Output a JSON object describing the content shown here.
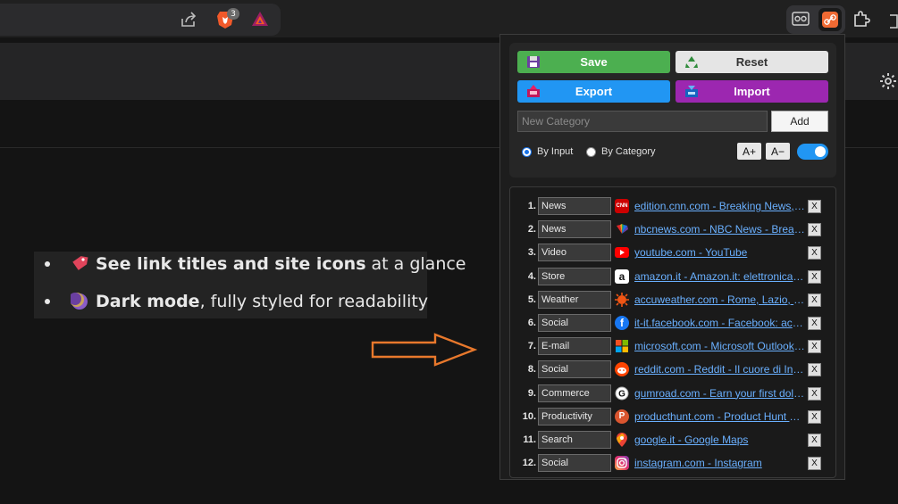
{
  "browser": {
    "brave_badge": "3"
  },
  "features": [
    {
      "bold": "See link titles and site icons",
      "rest": "at a glance"
    },
    {
      "bold": "Dark mode",
      "rest": ", fully styled for readability"
    }
  ],
  "popup": {
    "save_label": "Save",
    "reset_label": "Reset",
    "export_label": "Export",
    "import_label": "Import",
    "category_placeholder": "New Category",
    "add_label": "Add",
    "radio_by_input": "By Input",
    "radio_by_category": "By Category",
    "selected_mode": "By Input",
    "font_increase": "A+",
    "font_decrease": "A−",
    "dark_toggle_on": true,
    "colors": {
      "save": "#4caf50",
      "reset": "#e5e5e5",
      "export": "#2196f3",
      "import": "#9c27b0",
      "link": "#6ab0ff"
    }
  },
  "links": [
    {
      "num": "1.",
      "category": "News",
      "title": "edition.cnn.com - Breaking News, Latest News and Videos | CNN",
      "icon": "cnn-icon",
      "del": "X"
    },
    {
      "num": "2.",
      "category": "News",
      "title": "nbcnews.com - NBC News - Breaking News & Top Stories",
      "icon": "nbc-icon",
      "del": "X"
    },
    {
      "num": "3.",
      "category": "Video",
      "title": "youtube.com - YouTube",
      "icon": "youtube-icon",
      "del": "X"
    },
    {
      "num": "4.",
      "category": "Store",
      "title": "amazon.it - Amazon.it: elettronica, libri, musica",
      "icon": "amazon-icon",
      "del": "X"
    },
    {
      "num": "5.",
      "category": "Weather",
      "title": "accuweather.com - Rome, Lazio, Italy Weather",
      "icon": "accuweather-icon",
      "del": "X"
    },
    {
      "num": "6.",
      "category": "Social",
      "title": "it-it.facebook.com - Facebook: accedi o iscriviti",
      "icon": "facebook-icon",
      "del": "X"
    },
    {
      "num": "7.",
      "category": "E-mail",
      "title": "microsoft.com - Microsoft Outlook (formerly Hotmail)",
      "icon": "microsoft-icon",
      "del": "X"
    },
    {
      "num": "8.",
      "category": "Social",
      "title": "reddit.com - Reddit - Il cuore di Internet",
      "icon": "reddit-icon",
      "del": "X"
    },
    {
      "num": "9.",
      "category": "Commerce",
      "title": "gumroad.com - Earn your first dollar online",
      "icon": "gumroad-icon",
      "del": "X"
    },
    {
      "num": "10.",
      "category": "Productivity",
      "title": "producthunt.com - Product Hunt – The best new products",
      "icon": "producthunt-icon",
      "del": "X"
    },
    {
      "num": "11.",
      "category": "Search",
      "title": "google.it - Google Maps",
      "icon": "google-maps-icon",
      "del": "X"
    },
    {
      "num": "12.",
      "category": "Social",
      "title": "instagram.com - Instagram",
      "icon": "instagram-icon",
      "del": "X"
    }
  ]
}
